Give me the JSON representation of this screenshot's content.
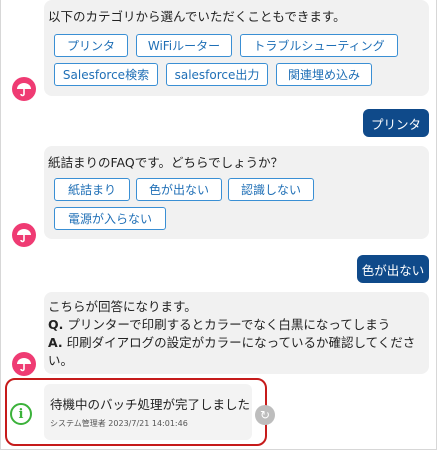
{
  "messages": {
    "categories": {
      "text": "以下のカテゴリから選んでいただくこともできます。",
      "options": [
        "プリンタ",
        "WiFiルーター",
        "トラブルシューティング",
        "Salesforce検索",
        "salesforce出力",
        "関連埋め込み"
      ]
    },
    "user_reply_1": "プリンタ",
    "faq": {
      "text": "紙詰まりのFAQです。どちらでしょうか？",
      "options": [
        "紙詰まり",
        "色が出ない",
        "認識しない",
        "電源が入らない"
      ]
    },
    "user_reply_2": "色が出ない",
    "answer": {
      "intro": "こちらが回答になります。",
      "q_label": "Q.",
      "q_text": " プリンターで印刷するとカラーでなく白黒になってしまう",
      "a_label": "A.",
      "a_text_line1": " 印刷ダイアログの設定がカラーになっているか確認してくださ",
      "a_text_line2": "い。"
    },
    "notice": {
      "text": "待機中のバッチ処理が完了しました",
      "meta": "システム管理者 2023/7/21 14:01:46"
    }
  },
  "icons": {
    "bot_avatar": "umbrella-icon",
    "info": "info-icon",
    "refresh": "refresh-icon"
  },
  "colors": {
    "accent": "#0f4a8a",
    "option_border": "#3a8fd4",
    "avatar": "#ef3b73",
    "info": "#3bb23a",
    "highlight": "#c61b1b"
  }
}
